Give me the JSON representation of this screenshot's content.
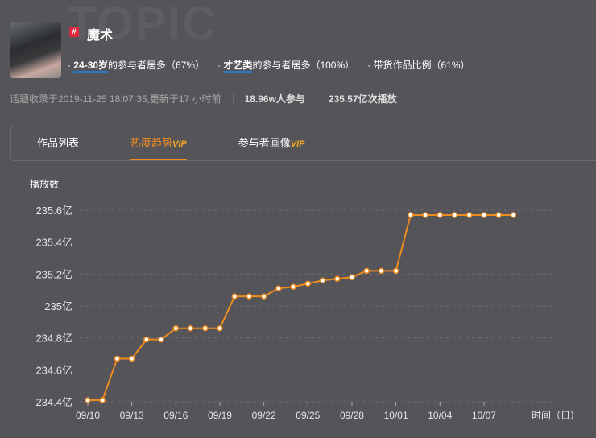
{
  "watermark": "TOPIC",
  "topic": {
    "hash": "#",
    "title": "魔术"
  },
  "tags": [
    {
      "prefix": "· ",
      "highlight": "24-30岁",
      "text": "的参与者居多（67%）"
    },
    {
      "prefix": "· ",
      "highlight": "才艺类",
      "text": "的参与者居多（100%）"
    },
    {
      "prefix": "· ",
      "highlight": "",
      "text": "带货作品比例（61%）"
    }
  ],
  "meta": {
    "recorded": "话题收录于2019-11-25 18:07:35,更新于17 小时前",
    "participants": "18.96w人参与",
    "plays": "235.57亿次播放"
  },
  "tabs": [
    {
      "label": "作品列表",
      "vip": ""
    },
    {
      "label": "热度趋势",
      "vip": "VIP"
    },
    {
      "label": "参与者画像",
      "vip": "VIP"
    }
  ],
  "colors": {
    "line": "#f08c1e",
    "accent": "#f08c1e",
    "tag_underline": "#2878c8"
  },
  "chart_data": {
    "type": "line",
    "title": "",
    "ylabel": "播放数",
    "xlabel": "时间（日）",
    "ylim": [
      234.4,
      235.6
    ],
    "yticks": [
      "234.4亿",
      "234.6亿",
      "234.8亿",
      "235亿",
      "235.2亿",
      "235.4亿",
      "235.6亿"
    ],
    "ytick_values": [
      234.4,
      234.6,
      234.8,
      235.0,
      235.2,
      235.4,
      235.6
    ],
    "xticks": [
      "09/10",
      "09/13",
      "09/16",
      "09/19",
      "09/22",
      "09/25",
      "09/28",
      "10/01",
      "10/04",
      "10/07"
    ],
    "x": [
      "09/10",
      "09/11",
      "09/12",
      "09/13",
      "09/14",
      "09/15",
      "09/16",
      "09/17",
      "09/18",
      "09/19",
      "09/20",
      "09/21",
      "09/22",
      "09/23",
      "09/24",
      "09/25",
      "09/26",
      "09/27",
      "09/28",
      "09/29",
      "09/30",
      "10/01",
      "10/02",
      "10/03",
      "10/04",
      "10/05",
      "10/06",
      "10/07",
      "10/08",
      "10/09"
    ],
    "values": [
      234.41,
      234.41,
      234.67,
      234.67,
      234.79,
      234.79,
      234.86,
      234.86,
      234.86,
      234.86,
      235.06,
      235.06,
      235.06,
      235.11,
      235.12,
      235.14,
      235.16,
      235.17,
      235.18,
      235.22,
      235.22,
      235.22,
      235.57,
      235.57,
      235.57,
      235.57,
      235.57,
      235.57,
      235.57,
      235.57
    ]
  }
}
